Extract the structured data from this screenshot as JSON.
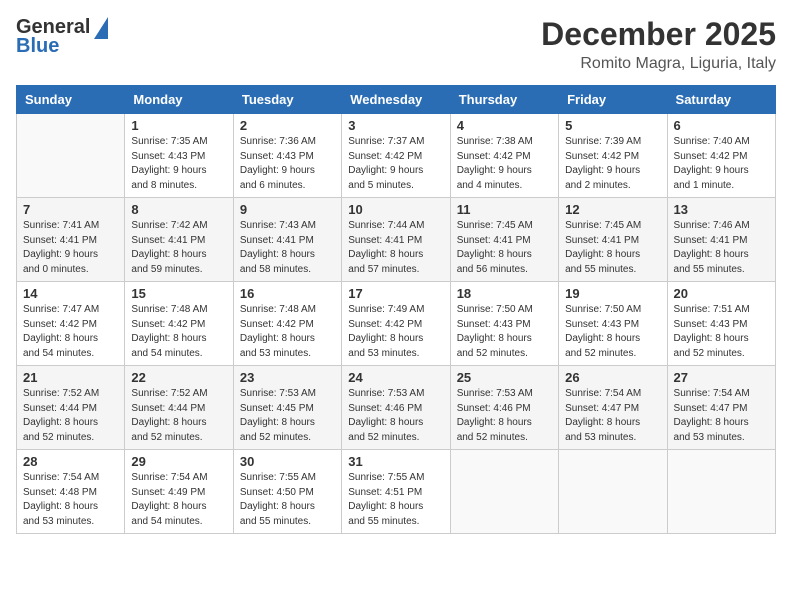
{
  "logo": {
    "general": "General",
    "blue": "Blue"
  },
  "title": "December 2025",
  "location": "Romito Magra, Liguria, Italy",
  "days_of_week": [
    "Sunday",
    "Monday",
    "Tuesday",
    "Wednesday",
    "Thursday",
    "Friday",
    "Saturday"
  ],
  "weeks": [
    [
      {
        "day": "",
        "info": ""
      },
      {
        "day": "1",
        "info": "Sunrise: 7:35 AM\nSunset: 4:43 PM\nDaylight: 9 hours\nand 8 minutes."
      },
      {
        "day": "2",
        "info": "Sunrise: 7:36 AM\nSunset: 4:43 PM\nDaylight: 9 hours\nand 6 minutes."
      },
      {
        "day": "3",
        "info": "Sunrise: 7:37 AM\nSunset: 4:42 PM\nDaylight: 9 hours\nand 5 minutes."
      },
      {
        "day": "4",
        "info": "Sunrise: 7:38 AM\nSunset: 4:42 PM\nDaylight: 9 hours\nand 4 minutes."
      },
      {
        "day": "5",
        "info": "Sunrise: 7:39 AM\nSunset: 4:42 PM\nDaylight: 9 hours\nand 2 minutes."
      },
      {
        "day": "6",
        "info": "Sunrise: 7:40 AM\nSunset: 4:42 PM\nDaylight: 9 hours\nand 1 minute."
      }
    ],
    [
      {
        "day": "7",
        "info": "Sunrise: 7:41 AM\nSunset: 4:41 PM\nDaylight: 9 hours\nand 0 minutes."
      },
      {
        "day": "8",
        "info": "Sunrise: 7:42 AM\nSunset: 4:41 PM\nDaylight: 8 hours\nand 59 minutes."
      },
      {
        "day": "9",
        "info": "Sunrise: 7:43 AM\nSunset: 4:41 PM\nDaylight: 8 hours\nand 58 minutes."
      },
      {
        "day": "10",
        "info": "Sunrise: 7:44 AM\nSunset: 4:41 PM\nDaylight: 8 hours\nand 57 minutes."
      },
      {
        "day": "11",
        "info": "Sunrise: 7:45 AM\nSunset: 4:41 PM\nDaylight: 8 hours\nand 56 minutes."
      },
      {
        "day": "12",
        "info": "Sunrise: 7:45 AM\nSunset: 4:41 PM\nDaylight: 8 hours\nand 55 minutes."
      },
      {
        "day": "13",
        "info": "Sunrise: 7:46 AM\nSunset: 4:41 PM\nDaylight: 8 hours\nand 55 minutes."
      }
    ],
    [
      {
        "day": "14",
        "info": "Sunrise: 7:47 AM\nSunset: 4:42 PM\nDaylight: 8 hours\nand 54 minutes."
      },
      {
        "day": "15",
        "info": "Sunrise: 7:48 AM\nSunset: 4:42 PM\nDaylight: 8 hours\nand 54 minutes."
      },
      {
        "day": "16",
        "info": "Sunrise: 7:48 AM\nSunset: 4:42 PM\nDaylight: 8 hours\nand 53 minutes."
      },
      {
        "day": "17",
        "info": "Sunrise: 7:49 AM\nSunset: 4:42 PM\nDaylight: 8 hours\nand 53 minutes."
      },
      {
        "day": "18",
        "info": "Sunrise: 7:50 AM\nSunset: 4:43 PM\nDaylight: 8 hours\nand 52 minutes."
      },
      {
        "day": "19",
        "info": "Sunrise: 7:50 AM\nSunset: 4:43 PM\nDaylight: 8 hours\nand 52 minutes."
      },
      {
        "day": "20",
        "info": "Sunrise: 7:51 AM\nSunset: 4:43 PM\nDaylight: 8 hours\nand 52 minutes."
      }
    ],
    [
      {
        "day": "21",
        "info": "Sunrise: 7:52 AM\nSunset: 4:44 PM\nDaylight: 8 hours\nand 52 minutes."
      },
      {
        "day": "22",
        "info": "Sunrise: 7:52 AM\nSunset: 4:44 PM\nDaylight: 8 hours\nand 52 minutes."
      },
      {
        "day": "23",
        "info": "Sunrise: 7:53 AM\nSunset: 4:45 PM\nDaylight: 8 hours\nand 52 minutes."
      },
      {
        "day": "24",
        "info": "Sunrise: 7:53 AM\nSunset: 4:46 PM\nDaylight: 8 hours\nand 52 minutes."
      },
      {
        "day": "25",
        "info": "Sunrise: 7:53 AM\nSunset: 4:46 PM\nDaylight: 8 hours\nand 52 minutes."
      },
      {
        "day": "26",
        "info": "Sunrise: 7:54 AM\nSunset: 4:47 PM\nDaylight: 8 hours\nand 53 minutes."
      },
      {
        "day": "27",
        "info": "Sunrise: 7:54 AM\nSunset: 4:47 PM\nDaylight: 8 hours\nand 53 minutes."
      }
    ],
    [
      {
        "day": "28",
        "info": "Sunrise: 7:54 AM\nSunset: 4:48 PM\nDaylight: 8 hours\nand 53 minutes."
      },
      {
        "day": "29",
        "info": "Sunrise: 7:54 AM\nSunset: 4:49 PM\nDaylight: 8 hours\nand 54 minutes."
      },
      {
        "day": "30",
        "info": "Sunrise: 7:55 AM\nSunset: 4:50 PM\nDaylight: 8 hours\nand 55 minutes."
      },
      {
        "day": "31",
        "info": "Sunrise: 7:55 AM\nSunset: 4:51 PM\nDaylight: 8 hours\nand 55 minutes."
      },
      {
        "day": "",
        "info": ""
      },
      {
        "day": "",
        "info": ""
      },
      {
        "day": "",
        "info": ""
      }
    ]
  ]
}
